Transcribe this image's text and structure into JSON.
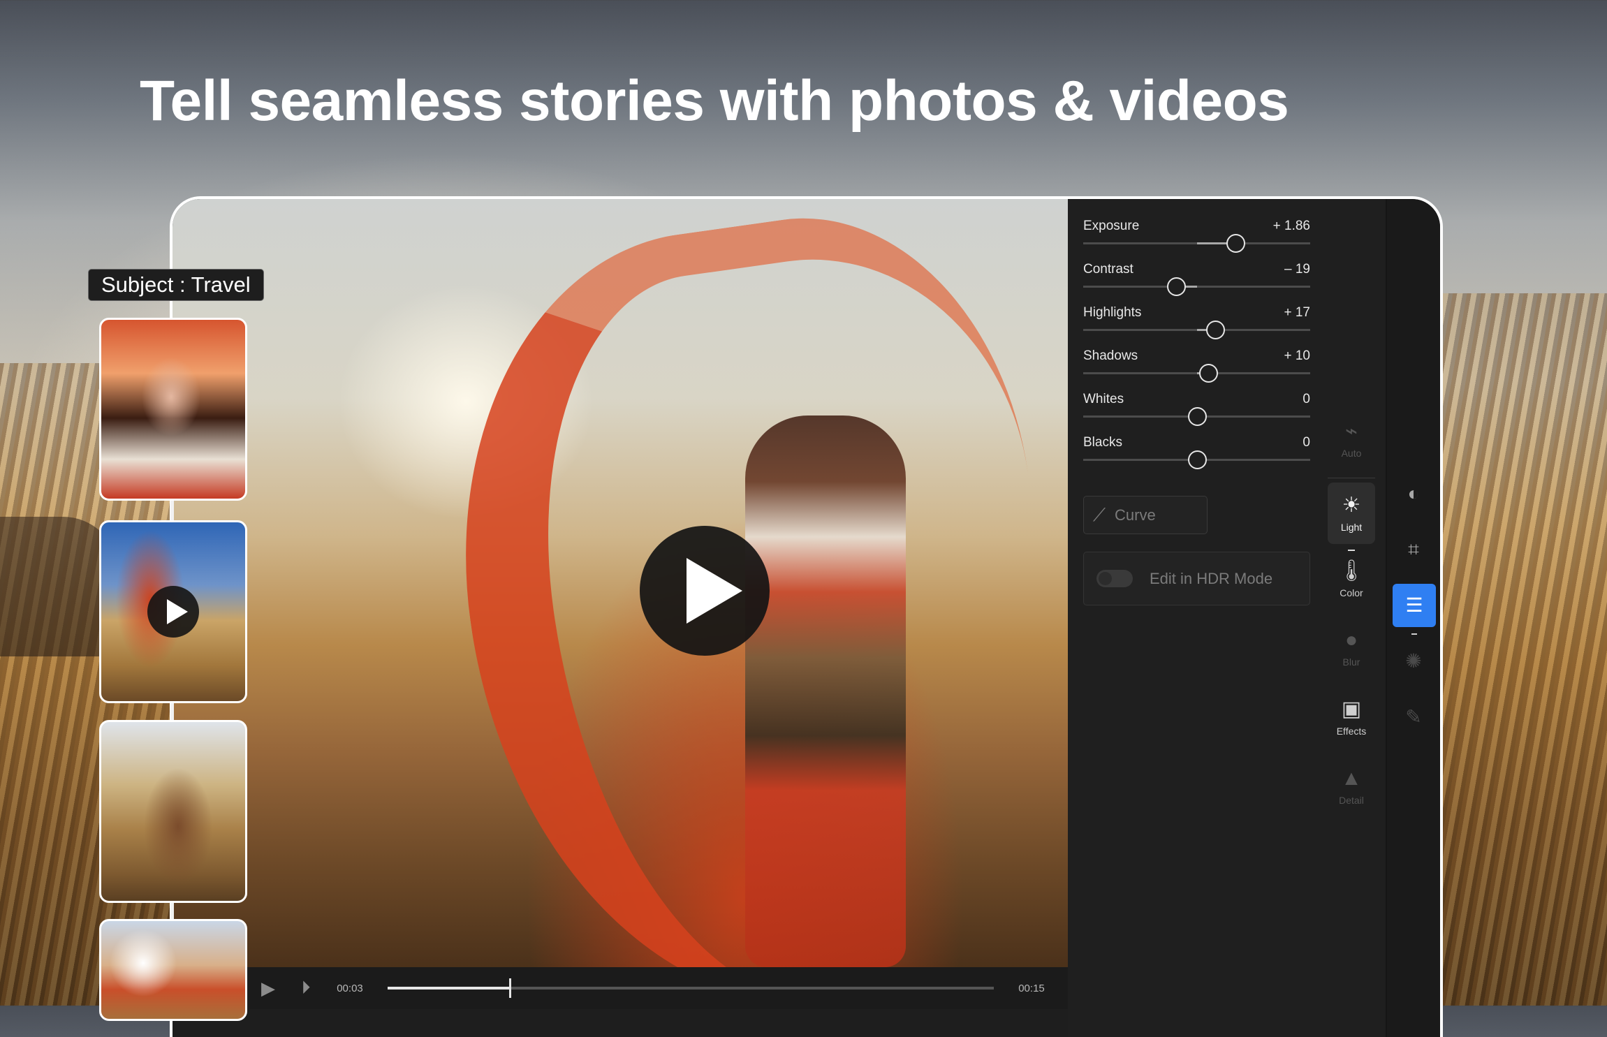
{
  "headline": "Tell seamless stories with photos & videos",
  "subject_badge": "Subject : Travel",
  "player": {
    "current_time": "00:03",
    "duration": "00:15",
    "progress": 0.2
  },
  "light_panel": {
    "sliders": [
      {
        "label": "Exposure",
        "value": "+ 1.86",
        "position": 0.67
      },
      {
        "label": "Contrast",
        "value": "– 19",
        "position": 0.41
      },
      {
        "label": "Highlights",
        "value": "+ 17",
        "position": 0.58
      },
      {
        "label": "Shadows",
        "value": "+ 10",
        "position": 0.55
      },
      {
        "label": "Whites",
        "value": "0",
        "position": 0.5
      },
      {
        "label": "Blacks",
        "value": "0",
        "position": 0.5
      }
    ],
    "curve_label": "Curve",
    "hdr_label": "Edit in HDR Mode",
    "hdr_enabled": false
  },
  "tools": [
    {
      "label": "Auto",
      "icon": "auto-wand-icon",
      "state": "disabled"
    },
    {
      "label": "Light",
      "icon": "sun-icon",
      "state": "active"
    },
    {
      "label": "Color",
      "icon": "thermometer-icon",
      "state": "normal"
    },
    {
      "label": "Blur",
      "icon": "droplet-icon",
      "state": "disabled"
    },
    {
      "label": "Effects",
      "icon": "effects-icon",
      "state": "normal"
    },
    {
      "label": "Detail",
      "icon": "triangle-icon",
      "state": "disabled"
    }
  ],
  "rail": [
    {
      "icon": "mask-icon",
      "state": "normal"
    },
    {
      "icon": "crop-icon",
      "state": "normal"
    },
    {
      "icon": "sliders-icon",
      "state": "selected"
    },
    {
      "icon": "presets-icon",
      "state": "disabled"
    },
    {
      "icon": "healing-brush-icon",
      "state": "disabled"
    }
  ],
  "colors": {
    "accent": "#2f7ff2",
    "panel_bg": "#1f1f1f",
    "text_primary": "#e8e8e8"
  }
}
